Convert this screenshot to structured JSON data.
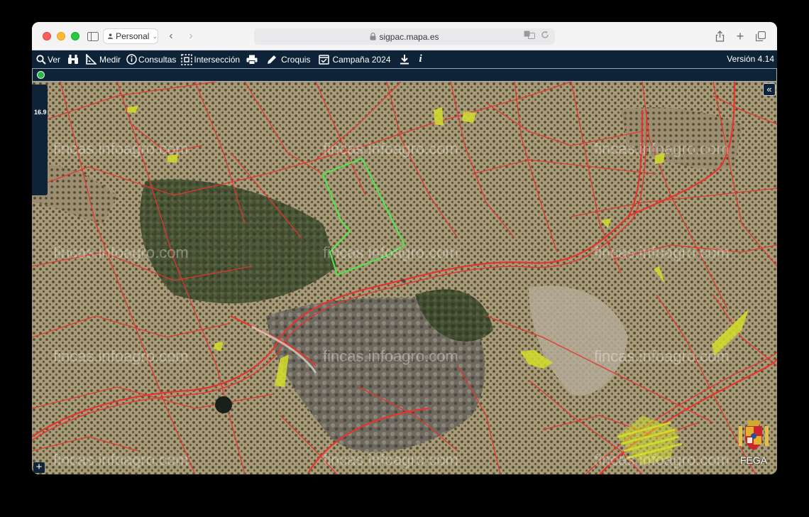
{
  "browser": {
    "profile_label": "Personal",
    "url": "sigpac.mapa.es"
  },
  "toolbar": {
    "items": [
      {
        "label": "Ver",
        "icon": "search-icon"
      },
      {
        "label": "",
        "icon": "binoculars-icon"
      },
      {
        "label": "Medir",
        "icon": "ruler-icon"
      },
      {
        "label": "Consultas",
        "icon": "info-circle-icon"
      },
      {
        "label": "Intersección",
        "icon": "intersection-icon"
      },
      {
        "label": "",
        "icon": "print-icon"
      },
      {
        "label": "Croquis",
        "icon": "pencil-icon"
      },
      {
        "label": "Campaña 2024",
        "icon": "calendar-icon"
      },
      {
        "label": "",
        "icon": "download-icon"
      },
      {
        "label": "i",
        "icon": "info-icon"
      }
    ],
    "version": "Versión 4.14"
  },
  "map": {
    "zoom_level": "16.9",
    "watermark": "fincas.infoagro.com",
    "logo_text": "FEGA",
    "collapse_glyph": "«",
    "plus_glyph": "+",
    "crosshair_glyph": "⌖"
  },
  "colors": {
    "toolbar_bg": "#0e2338",
    "parcel_border": "#e8342e",
    "selected_parcel": "#4ee84a",
    "highlight": "#d4e02a",
    "status_ok": "#28b94a"
  }
}
